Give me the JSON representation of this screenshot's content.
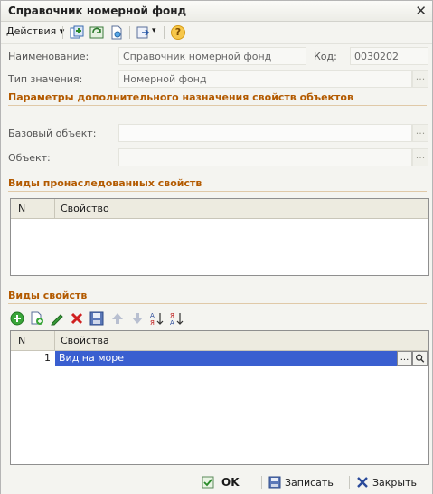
{
  "window": {
    "title": "Справочник номерной фонд",
    "close_glyph": "✕"
  },
  "toolbar": {
    "actions_label": "Действия",
    "actions_arrow": "▾",
    "icons": [
      "add-copy-icon",
      "refresh-icon",
      "document-icon",
      "go-icon",
      "help-icon"
    ],
    "help_glyph": "?"
  },
  "form": {
    "name_label": "Наименование:",
    "name_value": "Справочник номерной фонд",
    "code_label": "Код:",
    "code_value": "0030202",
    "type_label": "Тип значения:",
    "type_value": "Номерной фонд",
    "ellipsis": "..."
  },
  "params_section": {
    "title": "Параметры дополнительного назначения свойств объектов",
    "base_object_label": "Базовый объект:",
    "base_object_value": "",
    "object_label": "Объект:",
    "object_value": ""
  },
  "inherited_section": {
    "title": "Виды пронаследованных свойств",
    "columns": [
      "N",
      "Свойство"
    ],
    "rows": []
  },
  "properties_section": {
    "title": "Виды свойств",
    "toolbar_icons": [
      "add-icon",
      "copy-icon",
      "edit-icon",
      "delete-icon",
      "save-icon",
      "move-up-icon",
      "move-down-icon",
      "sort-asc-icon",
      "sort-desc-icon"
    ],
    "columns": [
      "N",
      "Свойства"
    ],
    "rows": [
      {
        "n": "1",
        "value": "Вид на море"
      }
    ],
    "row_btn_ellipsis": "...",
    "row_btn_search": "🔍"
  },
  "bottom": {
    "ok_label": "OK",
    "save_label": "Записать",
    "close_label": "Закрыть"
  },
  "colors": {
    "section_title": "#b35a00",
    "selection": "#3a5fd0",
    "accent_orange": "#f7c74a"
  }
}
